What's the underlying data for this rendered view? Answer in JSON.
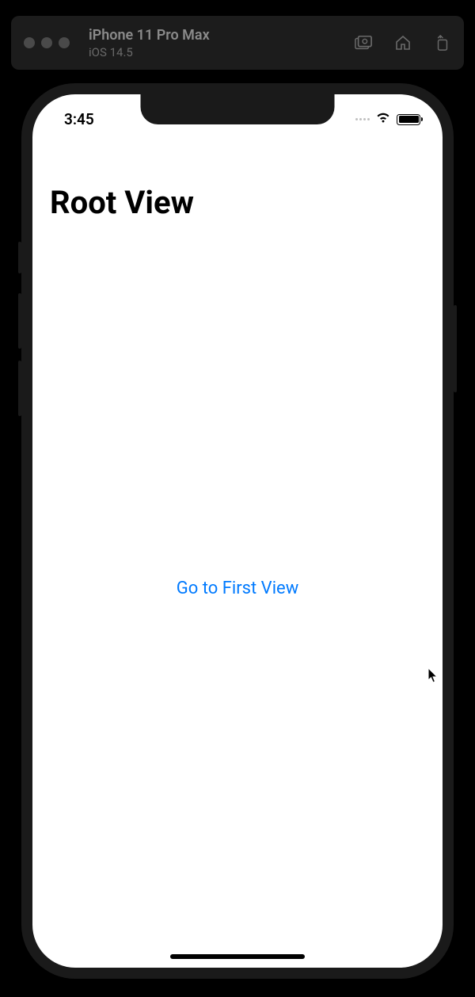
{
  "toolbar": {
    "title": "iPhone 11 Pro Max",
    "subtitle": "iOS 14.5"
  },
  "status_bar": {
    "time": "3:45"
  },
  "app": {
    "nav_title": "Root View",
    "link_label": "Go to First View"
  },
  "colors": {
    "tint": "#007AFF"
  }
}
